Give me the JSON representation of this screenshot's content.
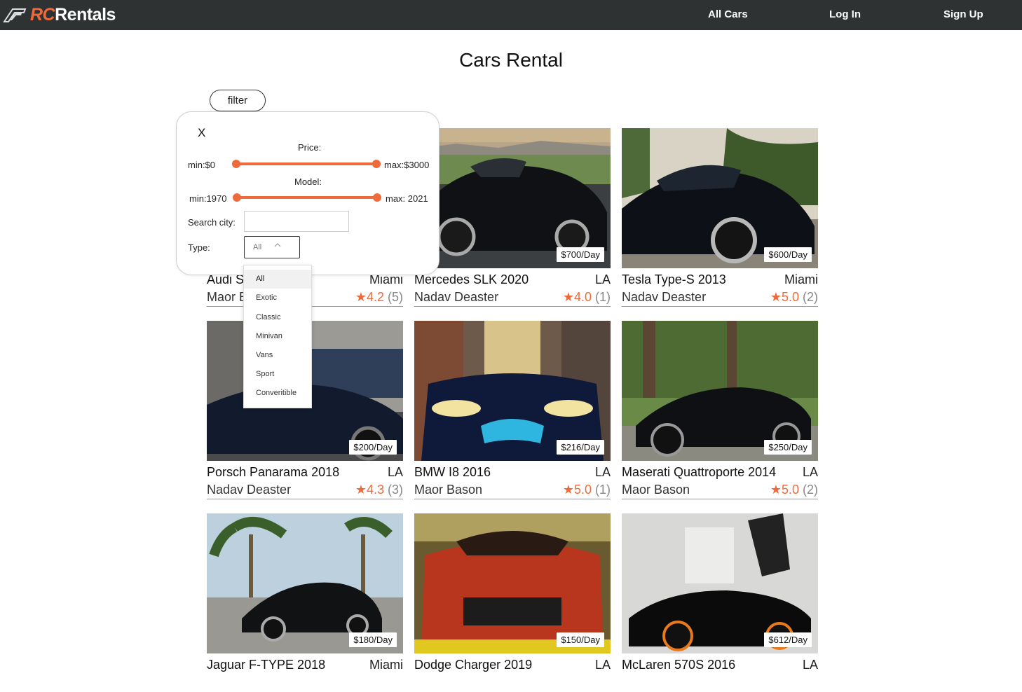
{
  "nav": {
    "logo_rc": "RC",
    "logo_rest": "Rentals",
    "links": [
      "All Cars",
      "Log In",
      "Sign Up"
    ]
  },
  "page_title": "Cars Rental",
  "filter_button": "filter",
  "filter_panel": {
    "close": "X",
    "price_label": "Price:",
    "price_min": "min:$0",
    "price_max": "max:$3000",
    "model_label": "Model:",
    "model_min": "min:1970",
    "model_max": "max: 2021",
    "city_label": "Search city:",
    "city_value": "",
    "type_label": "Type:",
    "type_selected": "All",
    "type_options": [
      "All",
      "Exotic",
      "Classic",
      "Minivan",
      "Vans",
      "Sport",
      "Converitible"
    ]
  },
  "cars": [
    {
      "name": "Audi S",
      "city": "Miami",
      "owner": "Maor B",
      "rating": "★4.2",
      "count": "(5)",
      "price": ""
    },
    {
      "name": "Mercedes SLK 2020",
      "city": "LA",
      "owner": "Nadav Deaster",
      "rating": "★4.0",
      "count": "(1)",
      "price": "$700/Day"
    },
    {
      "name": "Tesla Type-S 2013",
      "city": "Miami",
      "owner": "Nadav Deaster",
      "rating": "★5.0",
      "count": "(2)",
      "price": "$600/Day"
    },
    {
      "name": "Porsch Panarama 2018",
      "city": "LA",
      "owner": "Nadav Deaster",
      "rating": "★4.3",
      "count": "(3)",
      "price": "$200/Day"
    },
    {
      "name": "BMW I8 2016",
      "city": "LA",
      "owner": "Maor Bason",
      "rating": "★5.0",
      "count": "(1)",
      "price": "$216/Day"
    },
    {
      "name": "Maserati Quattroporte 2014",
      "city": "LA",
      "owner": "Maor Bason",
      "rating": "★5.0",
      "count": "(2)",
      "price": "$250/Day"
    },
    {
      "name": "Jaguar F-TYPE 2018",
      "city": "Miami",
      "owner": "",
      "rating": "",
      "count": "",
      "price": "$180/Day"
    },
    {
      "name": "Dodge Charger 2019",
      "city": "LA",
      "owner": "",
      "rating": "",
      "count": "",
      "price": "$150/Day"
    },
    {
      "name": "McLaren 570S 2016",
      "city": "LA",
      "owner": "",
      "rating": "",
      "count": "",
      "price": "$612/Day"
    }
  ],
  "colors": {
    "accent": "#ef6a3a",
    "navbar": "#2e3232"
  }
}
